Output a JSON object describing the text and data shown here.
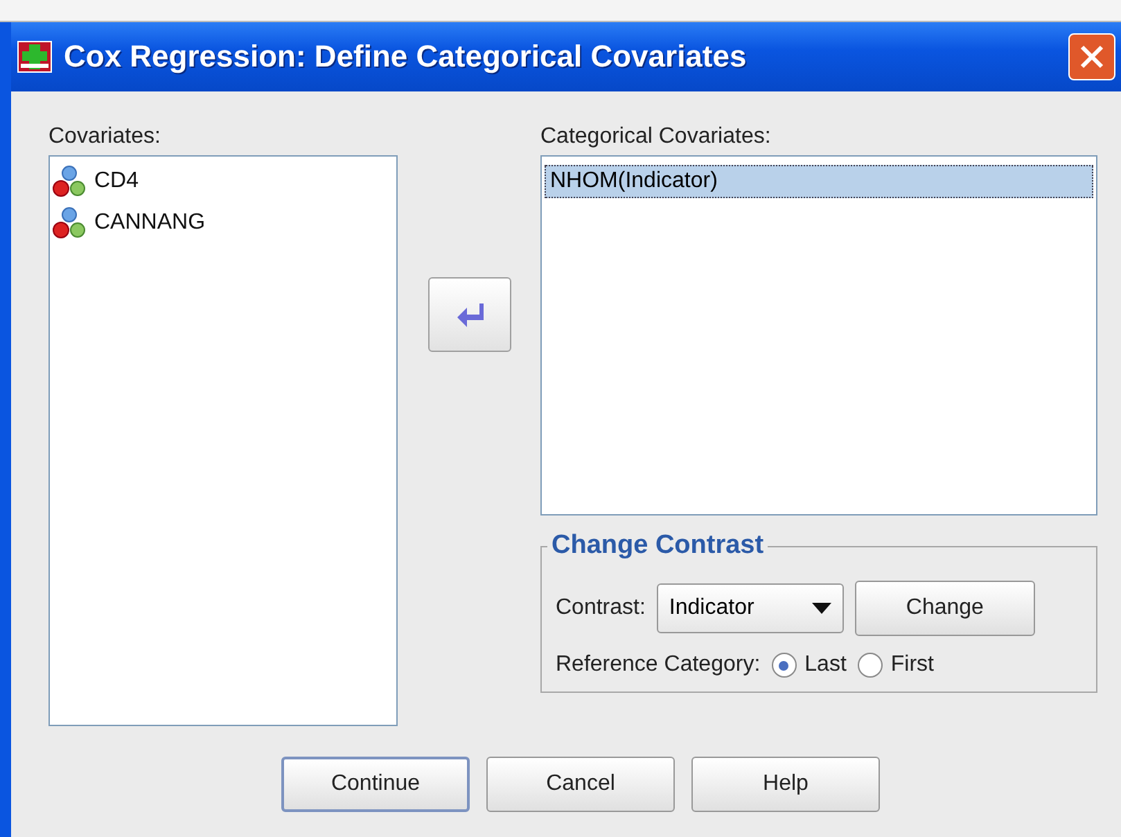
{
  "window": {
    "title": "Cox Regression: Define Categorical Covariates"
  },
  "covariates": {
    "label": "Covariates:",
    "items": [
      {
        "name": "CD4"
      },
      {
        "name": "CANNANG"
      }
    ]
  },
  "categorical": {
    "label": "Categorical Covariates:",
    "items": [
      {
        "name": "NHOM(Indicator)",
        "selected": true
      }
    ]
  },
  "change_contrast": {
    "title": "Change Contrast",
    "contrast_label": "Contrast:",
    "contrast_value": "Indicator",
    "change_button": "Change",
    "reference_label": "Reference Category:",
    "options": [
      {
        "label": "Last",
        "selected": true
      },
      {
        "label": "First",
        "selected": false
      }
    ]
  },
  "buttons": [
    {
      "label": "Continue",
      "default": true
    },
    {
      "label": "Cancel",
      "default": false
    },
    {
      "label": "Help",
      "default": false
    }
  ]
}
